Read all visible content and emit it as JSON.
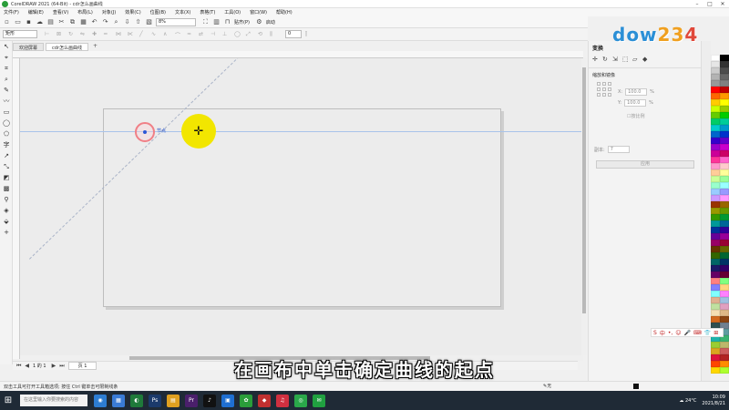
{
  "window": {
    "title": "CorelDRAW 2021 (64-Bit) - cdr怎么画曲线",
    "controls": [
      "–",
      "□",
      "✕"
    ]
  },
  "menubar": {
    "items": [
      "文件(F)",
      "编辑(E)",
      "查看(V)",
      "布局(L)",
      "对象(J)",
      "效果(C)",
      "位图(B)",
      "文本(X)",
      "表格(T)",
      "工具(O)",
      "窗口(W)",
      "帮助(H)"
    ]
  },
  "toolbar": {
    "zoom": "8%",
    "snap_label": "贴齐(P)",
    "launch_label": "启动"
  },
  "propbar": {
    "object_type": "矩形",
    "node_count": "0"
  },
  "doc_tabs": {
    "tabs": [
      "欢迎屏幕",
      "cdr怎么画曲线"
    ],
    "active": 1,
    "add": "+"
  },
  "canvas": {
    "node_label": "节点",
    "cursor_glyph": "✛"
  },
  "page_nav": {
    "first": "⏮",
    "prev": "◀",
    "count": "1 的 1",
    "next": "▶",
    "last": "⏭",
    "page_tab": "页 1"
  },
  "subtitle": "在画布中单击确定曲线的起点",
  "status": {
    "hint": "双击工具可打开工具箱选项; 按住 Ctrl 键单击可限制线条",
    "fill_label": "无"
  },
  "panel": {
    "title": "变换",
    "section": "缩放和镜像",
    "x_label": "X:",
    "x_value": "100.0",
    "y_label": "Y:",
    "y_value": "100.0",
    "pct": "%",
    "proportional": "按比例",
    "copies_label": "副本:",
    "copies_value": "7",
    "apply": "应用"
  },
  "palette": {
    "colors": [
      "#ffffff",
      "#000000",
      "#e6e6e6",
      "#333333",
      "#cccccc",
      "#4d4d4d",
      "#b3b3b3",
      "#666666",
      "#999999",
      "#808080",
      "#ff0000",
      "#c00000",
      "#ff6600",
      "#ff9900",
      "#ffcc00",
      "#ffff00",
      "#ccff00",
      "#99cc00",
      "#66cc00",
      "#00cc00",
      "#00cc66",
      "#00cc99",
      "#00cccc",
      "#0099cc",
      "#0066cc",
      "#0033cc",
      "#3300cc",
      "#6600cc",
      "#9900cc",
      "#cc00cc",
      "#cc0099",
      "#cc0066",
      "#ff3399",
      "#ff66cc",
      "#ff99cc",
      "#ffcccc",
      "#ffcc99",
      "#ffff99",
      "#ccff99",
      "#99ff99",
      "#99ffcc",
      "#99ffff",
      "#99ccff",
      "#9999ff",
      "#cc99ff",
      "#ff99ff",
      "#993300",
      "#996600",
      "#999900",
      "#669900",
      "#339900",
      "#009933",
      "#009999",
      "#006699",
      "#003399",
      "#330099",
      "#660099",
      "#990099",
      "#990066",
      "#990033",
      "#663300",
      "#666600",
      "#336600",
      "#006633",
      "#006666",
      "#003366",
      "#1a1a66",
      "#330066",
      "#660066",
      "#660033",
      "#ff8080",
      "#80ff80",
      "#8080ff",
      "#ffd480",
      "#80ffff",
      "#ff80ff",
      "#e0b090",
      "#a0c0e0",
      "#c0e0a0",
      "#e0a0c0",
      "#f5deb3",
      "#deb887",
      "#d2691e",
      "#8b4513",
      "#2f4f4f",
      "#708090",
      "#4682b4",
      "#5f9ea0",
      "#20b2aa",
      "#3cb371",
      "#9acd32",
      "#bdb76b",
      "#daa520",
      "#cd5c5c",
      "#dc143c",
      "#b22222",
      "#ff4500",
      "#ff8c00",
      "#ffd700",
      "#adff2f"
    ]
  },
  "watermark": {
    "a": "dow",
    "b": "23",
    "c": "4"
  },
  "ime": {
    "items": [
      "S",
      "中",
      "•,",
      "☺",
      "🎤",
      "⌨",
      "👕",
      "⊞"
    ]
  },
  "taskbar": {
    "start": "⊞",
    "search_placeholder": "在这里输入你要搜索的内容",
    "apps": [
      {
        "label": "◉",
        "color": "#2d7dd2"
      },
      {
        "label": "▦",
        "color": "#3a7bd5"
      },
      {
        "label": "◐",
        "color": "#1f7a3a"
      },
      {
        "label": "Ps",
        "color": "#1b3a6b"
      },
      {
        "label": "▤",
        "color": "#e0a020"
      },
      {
        "label": "Pr",
        "color": "#4a1f6b"
      },
      {
        "label": "♪",
        "color": "#111111"
      },
      {
        "label": "▣",
        "color": "#1f6fd2"
      },
      {
        "label": "✿",
        "color": "#2a9d3a"
      },
      {
        "label": "◆",
        "color": "#c03030"
      },
      {
        "label": "♫",
        "color": "#d03040"
      },
      {
        "label": "◎",
        "color": "#2aa84a"
      },
      {
        "label": "✉",
        "color": "#20a040"
      }
    ],
    "weather": "☁ 24°C",
    "time": "10:09",
    "date": "2021/8/21"
  }
}
